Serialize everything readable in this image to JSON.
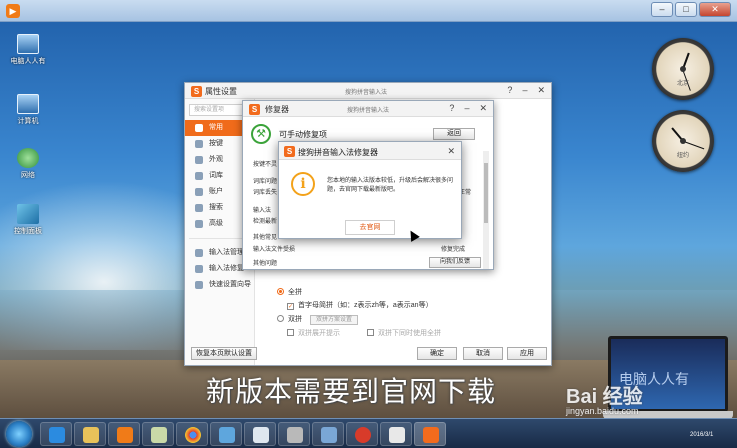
{
  "desktop": {
    "icons": [
      {
        "name": "computer",
        "label": "电脑人人有"
      },
      {
        "name": "computer2",
        "label": "计算机"
      },
      {
        "name": "network",
        "label": "网络"
      },
      {
        "name": "control-panel",
        "label": "控制面板"
      }
    ],
    "clocks": [
      {
        "label": "北京"
      },
      {
        "label": "纽约"
      }
    ]
  },
  "settings_window": {
    "title": "属性设置",
    "center_text": "搜狗拼音输入法",
    "search_placeholder": "搜索设置项",
    "nav": [
      {
        "label": "常用",
        "active": true
      },
      {
        "label": "按键"
      },
      {
        "label": "外观"
      },
      {
        "label": "词库"
      },
      {
        "label": "账户"
      },
      {
        "label": "搜索"
      },
      {
        "label": "高级"
      }
    ],
    "nav_bottom": [
      {
        "label": "输入法管理"
      },
      {
        "label": "输入法修复"
      },
      {
        "label": "快速设置向导"
      }
    ],
    "options": {
      "full_pinyin": "全拼",
      "initials": "首字母简拼（如：z表示zh等，a表示an等）",
      "shuangpin": "双拼",
      "shuangpin_scheme": "双拼方案设置",
      "shuangpin_hint": "双拼展开提示",
      "shuangpin_full": "双拼下同时使用全拼"
    },
    "footer": {
      "restore": "恢复本页默认设置",
      "ok": "确定",
      "cancel": "取消",
      "apply": "应用"
    }
  },
  "repair_window": {
    "title": "修复器",
    "center_text": "搜狗拼音输入法",
    "header": "可手动修复项",
    "back": "返回",
    "rows": [
      {
        "label": "按键不灵",
        "status": ""
      },
      {
        "label": "词库问题",
        "status": ""
      },
      {
        "label": "词库丢失",
        "status": "正常"
      },
      {
        "label": "输入法",
        "status": ""
      },
      {
        "label": "检测最新",
        "status": ""
      },
      {
        "label": "其他常见",
        "status": ""
      },
      {
        "label": "输入法文件受损",
        "status": "修复完成"
      },
      {
        "label": "其他问题",
        "status": ""
      }
    ],
    "feedback": "向我们反馈"
  },
  "dialog": {
    "title": "搜狗拼音输入法修复器",
    "message": "您本地的输入法版本较低，升级后会解决很多问题，去官网下载最新版吧。",
    "button": "去官网"
  },
  "caption": "新版本需要到官网下载",
  "watermark": {
    "brand": "Bai 经验",
    "url": "jingyan.baidu.com"
  },
  "laptop_text": "电脑人人有",
  "date": "2016/3/1"
}
